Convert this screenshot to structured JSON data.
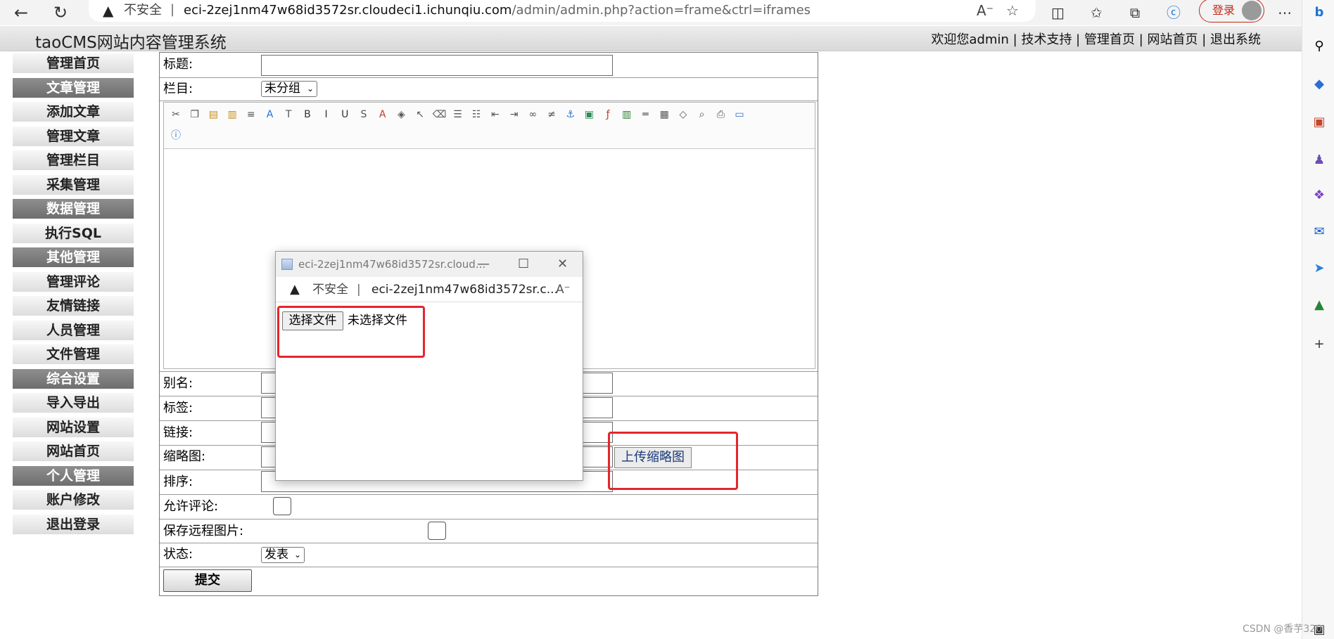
{
  "browser": {
    "security": "不安全",
    "url_host": "eci-2zej1nm47w68id3572sr.cloudeci1.ichunqiu.com",
    "url_path": "/admin/admin.php?action=frame&ctrl=iframes",
    "login_label": "登录",
    "icons": [
      "back-icon",
      "refresh-icon",
      "warning-icon",
      "read-aloud-icon",
      "favorite-add-icon",
      "split-screen-icon",
      "favorites-icon",
      "collections-icon",
      "edge-icon",
      "avatar-icon",
      "more-icon"
    ]
  },
  "sidebar_rail_icons": [
    "bing-icon",
    "search-icon",
    "tag-icon",
    "toolbox-icon",
    "games-icon",
    "office-icon",
    "outlook-icon",
    "send-icon",
    "tree-icon",
    "add-icon",
    "layout-icon"
  ],
  "cms": {
    "title": "taoCMS网站内容管理系统",
    "welcome": "欢迎您admin",
    "nav": [
      "技术支持",
      "管理首页",
      "网站首页",
      "退出系统"
    ]
  },
  "sidebar": [
    {
      "label": "管理首页",
      "type": "item"
    },
    {
      "label": "文章管理",
      "type": "group"
    },
    {
      "label": "添加文章",
      "type": "item"
    },
    {
      "label": "管理文章",
      "type": "item"
    },
    {
      "label": "管理栏目",
      "type": "item"
    },
    {
      "label": "采集管理",
      "type": "item"
    },
    {
      "label": "数据管理",
      "type": "group"
    },
    {
      "label": "执行SQL",
      "type": "item"
    },
    {
      "label": "其他管理",
      "type": "group"
    },
    {
      "label": "管理评论",
      "type": "item"
    },
    {
      "label": "友情链接",
      "type": "item"
    },
    {
      "label": "人员管理",
      "type": "item"
    },
    {
      "label": "文件管理",
      "type": "item"
    },
    {
      "label": "综合设置",
      "type": "group"
    },
    {
      "label": "导入导出",
      "type": "item"
    },
    {
      "label": "网站设置",
      "type": "item"
    },
    {
      "label": "网站首页",
      "type": "item"
    },
    {
      "label": "个人管理",
      "type": "group"
    },
    {
      "label": "账户修改",
      "type": "item"
    },
    {
      "label": "退出登录",
      "type": "item"
    }
  ],
  "form": {
    "title_label": "标题:",
    "title_value": "",
    "category_label": "栏目:",
    "category_value": "未分组",
    "alias_label": "别名:",
    "tags_label": "标签:",
    "link_label": "链接:",
    "thumb_label": "缩略图:",
    "upload_thumb": "上传缩略图",
    "order_label": "排序:",
    "allow_comment_label": "允许评论:",
    "save_remote_label": "保存远程图片:",
    "status_label": "状态:",
    "status_value": "发表",
    "submit": "提交"
  },
  "editor_icons": [
    "cut-icon",
    "copy-icon",
    "paste-icon",
    "paste-word-icon",
    "align-icon",
    "font-icon",
    "font-size-icon",
    "bold-icon",
    "italic-icon",
    "underline-icon",
    "strike-icon",
    "text-color-icon",
    "bg-color-icon",
    "select-icon",
    "eraser-icon",
    "ordered-list-icon",
    "unordered-list-icon",
    "outdent-icon",
    "indent-icon",
    "link-icon",
    "unlink-icon",
    "anchor-icon",
    "image-icon",
    "flash-icon",
    "media-icon",
    "hr-icon",
    "table-icon",
    "source-icon",
    "preview-icon",
    "print-icon",
    "fullscreen-icon",
    "about-icon"
  ],
  "popup": {
    "title": "eci-2zej1nm47w68id3572sr.cloud...",
    "security": "不安全",
    "url": "eci-2zej1nm47w68id3572sr.c...",
    "choose_file": "选择文件",
    "no_file": "未选择文件"
  },
  "watermark": "CSDN @香芋320"
}
